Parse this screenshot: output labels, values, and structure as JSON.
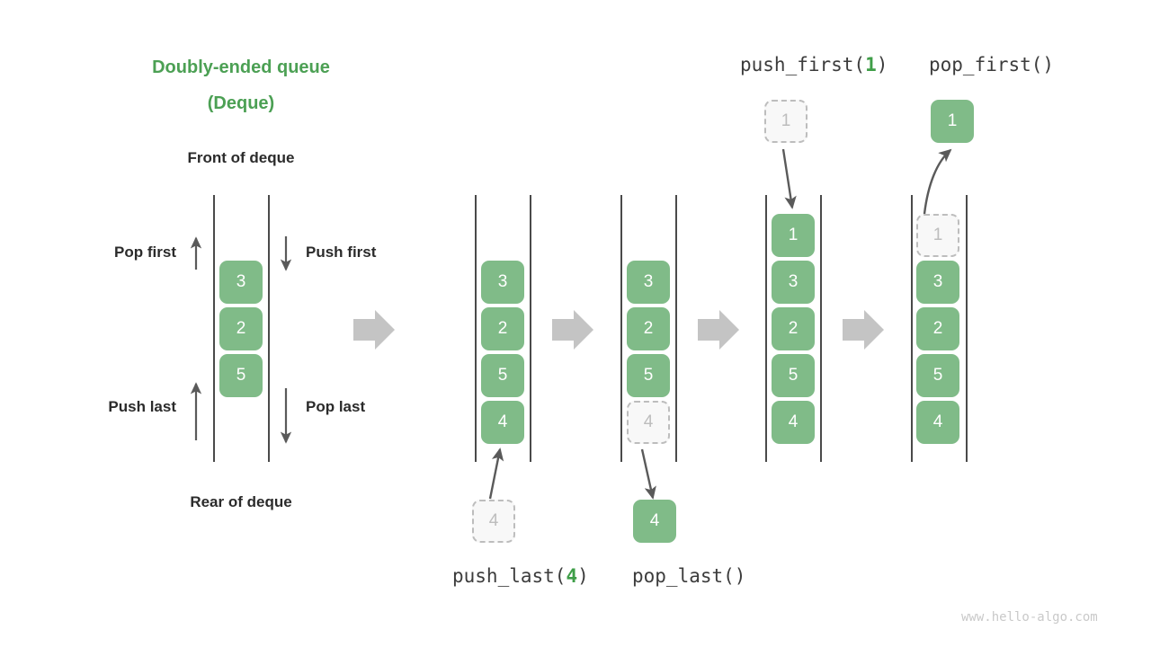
{
  "title": {
    "line1": "Doubly-ended queue",
    "line2": "(Deque)"
  },
  "labels": {
    "front": "Front of deque",
    "rear": "Rear of deque",
    "pop_first": "Pop first",
    "push_first": "Push first",
    "push_last": "Push last",
    "pop_last": "Pop last"
  },
  "operations": {
    "push_last": {
      "name": "push_last(",
      "arg": "4",
      "close": ")"
    },
    "pop_last": {
      "name": "pop_last()"
    },
    "push_first": {
      "name": "push_first(",
      "arg": "1",
      "close": ")"
    },
    "pop_first": {
      "name": "pop_first()"
    }
  },
  "watermark": "www.hello-algo.com",
  "colors": {
    "title_green": "#4ca054",
    "box_green": "#80bb88",
    "ghost_border": "#bdbdbd",
    "ghost_fill": "#f8f8f8",
    "rail": "#4a4a4a",
    "thin_arrow": "#5a5a5a",
    "block_arrow": "#c4c4c4",
    "watermark": "#c9c9c9"
  },
  "columns": [
    {
      "id": "initial",
      "cells": [
        {
          "value": "3",
          "state": "solid"
        },
        {
          "value": "2",
          "state": "solid"
        },
        {
          "value": "5",
          "state": "solid"
        }
      ],
      "external": []
    },
    {
      "id": "after-push-last",
      "cells": [
        {
          "value": "3",
          "state": "solid"
        },
        {
          "value": "2",
          "state": "solid"
        },
        {
          "value": "5",
          "state": "solid"
        },
        {
          "value": "4",
          "state": "solid"
        }
      ],
      "external": [
        {
          "value": "4",
          "state": "ghost",
          "position": "below"
        }
      ]
    },
    {
      "id": "after-pop-last",
      "cells": [
        {
          "value": "3",
          "state": "solid"
        },
        {
          "value": "2",
          "state": "solid"
        },
        {
          "value": "5",
          "state": "solid"
        },
        {
          "value": "4",
          "state": "ghost"
        }
      ],
      "external": [
        {
          "value": "4",
          "state": "solid",
          "position": "below"
        }
      ]
    },
    {
      "id": "after-push-first",
      "cells": [
        {
          "value": "1",
          "state": "solid"
        },
        {
          "value": "3",
          "state": "solid"
        },
        {
          "value": "2",
          "state": "solid"
        },
        {
          "value": "5",
          "state": "solid"
        },
        {
          "value": "4",
          "state": "solid"
        }
      ],
      "external": [
        {
          "value": "1",
          "state": "ghost",
          "position": "above"
        }
      ]
    },
    {
      "id": "after-pop-first",
      "cells": [
        {
          "value": "1",
          "state": "ghost"
        },
        {
          "value": "3",
          "state": "solid"
        },
        {
          "value": "2",
          "state": "solid"
        },
        {
          "value": "5",
          "state": "solid"
        },
        {
          "value": "4",
          "state": "solid"
        }
      ],
      "external": [
        {
          "value": "1",
          "state": "solid",
          "position": "above"
        }
      ]
    }
  ]
}
